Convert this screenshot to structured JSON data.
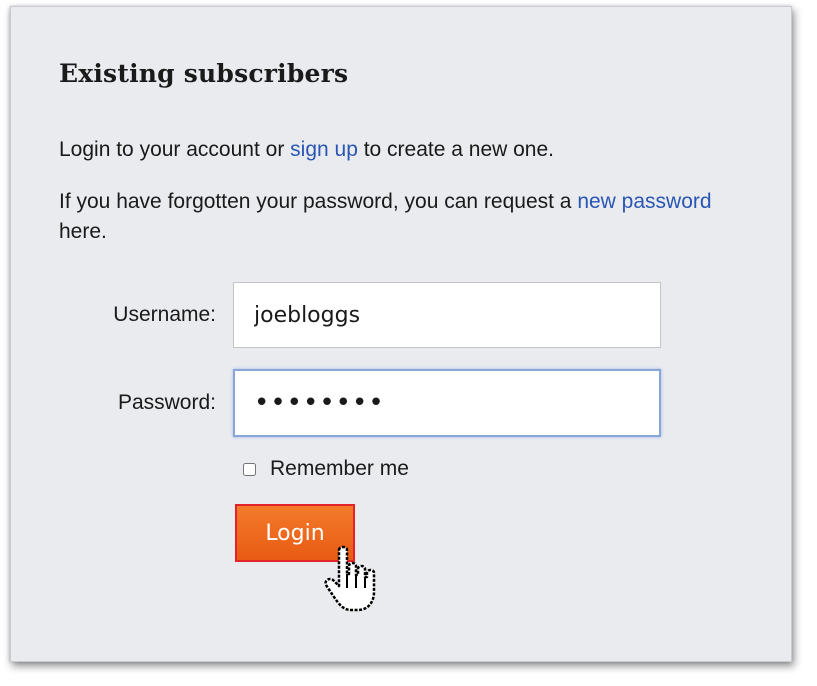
{
  "login_panel": {
    "heading": "Existing subscribers",
    "intro": {
      "before": "Login to your account or ",
      "signup_link": "sign up",
      "after": " to create a new one."
    },
    "forgot": {
      "before": "If you have forgotten your password, you can request a ",
      "new_password_link": "new password",
      "after": " here."
    },
    "username": {
      "label": "Username:",
      "value": "joebloggs"
    },
    "password": {
      "label": "Password:",
      "value": "••••••••"
    },
    "remember_me": {
      "label": "Remember me",
      "checked": false
    },
    "login_button": "Login"
  },
  "colors": {
    "panel_background": "#e9ebef",
    "link": "#2a56b3",
    "button_orange": "#f0681e",
    "button_border": "#e2242a",
    "focus_border": "#8aa6d9"
  },
  "icons": {
    "pointer": "hand-pointer-icon"
  }
}
